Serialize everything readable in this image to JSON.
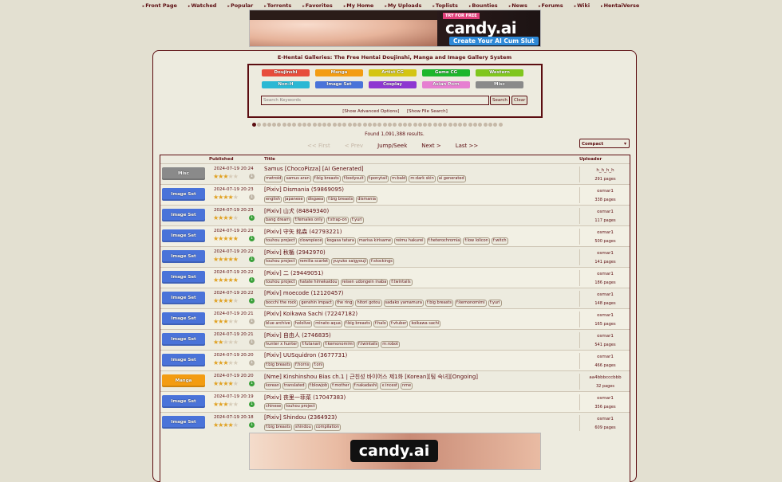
{
  "nav": [
    "Front Page",
    "Watched",
    "Popular",
    "Torrents",
    "Favorites",
    "My Home",
    "My Uploads",
    "Toplists",
    "Bounties",
    "News",
    "Forums",
    "Wiki",
    "HentaiVerse"
  ],
  "ad_top": {
    "try": "TRY FOR FREE",
    "brand": "candy.ai",
    "cta": "Create Your AI Cum Slut"
  },
  "ad_bottom": {
    "brand": "candy.ai"
  },
  "site_title": "E-Hentai Galleries: The Free Hentai Doujinshi, Manga and Image Gallery System",
  "categories": [
    {
      "label": "Doujinshi",
      "color": "#e74c3c"
    },
    {
      "label": "Manga",
      "color": "#f39c12"
    },
    {
      "label": "Artist CG",
      "color": "#d4c514"
    },
    {
      "label": "Game CG",
      "color": "#1db62c"
    },
    {
      "label": "Western",
      "color": "#80c61d"
    },
    {
      "label": "Non-H",
      "color": "#2bb8d4"
    },
    {
      "label": "Image Set",
      "color": "#4a73d9"
    },
    {
      "label": "Cosplay",
      "color": "#8e37d1"
    },
    {
      "label": "Asian Porn",
      "color": "#e67fd1"
    },
    {
      "label": "Misc",
      "color": "#8a8a8a"
    }
  ],
  "search": {
    "placeholder": "Search Keywords",
    "search_btn": "Search",
    "clear_btn": "Clear",
    "advanced": "[Show Advanced Options]",
    "file": "[Show File Search]"
  },
  "found": "Found 1,091,388 results.",
  "pager": {
    "first": "<< First",
    "prev": "< Prev",
    "jump": "Jump/Seek",
    "next": "Next >",
    "last": "Last >>"
  },
  "display_mode": "Compact",
  "table_headers": {
    "published": "Published",
    "title": "Title",
    "uploader": "Uploader"
  },
  "rows": [
    {
      "cat": "Misc",
      "color": "#8a8a8a",
      "date": "2024-07-19 20:24",
      "rating": 2.5,
      "title": "Samus [ChocoPizza] [AI Generated]",
      "tags": [
        "metroid",
        "samus aran",
        "f:big breasts",
        "f:bodysuit",
        "f:ponytail",
        "m:bald",
        "m:dark skin",
        "ai generated"
      ],
      "uploader": "h_h_h_h",
      "pages": "291 pages",
      "dl": "grey"
    },
    {
      "cat": "Image Set",
      "color": "#4a73d9",
      "date": "2024-07-19 20:23",
      "rating": 4,
      "title": "[Pixiv] Dismania (59869095)",
      "tags": [
        "english",
        "japanese",
        "disgaea",
        "f:big breasts",
        "dismania"
      ],
      "uploader": "osmar1",
      "pages": "338 pages",
      "dl": "grey"
    },
    {
      "cat": "Image Set",
      "color": "#4a73d9",
      "date": "2024-07-19 20:23",
      "rating": 3.5,
      "title": "[Pixiv] 山犬 (84849340)",
      "tags": [
        "bang dream",
        "f:females only",
        "f:strap-on",
        "f:yuri"
      ],
      "uploader": "osmar1",
      "pages": "117 pages",
      "dl": "green"
    },
    {
      "cat": "Image Set",
      "color": "#4a73d9",
      "date": "2024-07-19 20:23",
      "rating": 4.5,
      "title": "[Pixiv] 守矢 銘森 (42793221)",
      "tags": [
        "touhou project",
        "clownpiece",
        "kogasa tatara",
        "marisa kirisame",
        "reimu hakurei",
        "f:heterochromia",
        "f:low lolicon",
        "f:witch"
      ],
      "uploader": "osmar1",
      "pages": "500 pages",
      "dl": "green"
    },
    {
      "cat": "Image Set",
      "color": "#4a73d9",
      "date": "2024-07-19 20:22",
      "rating": 4.5,
      "title": "[Pixiv] 秋楯 (2942970)",
      "tags": [
        "touhou project",
        "remilia scarlet",
        "yuyuko saigyouji",
        "f:stockings"
      ],
      "uploader": "osmar1",
      "pages": "141 pages",
      "dl": "green"
    },
    {
      "cat": "Image Set",
      "color": "#4a73d9",
      "date": "2024-07-19 20:22",
      "rating": 4.5,
      "title": "[Pixiv] 二 (29449051)",
      "tags": [
        "touhou project",
        "hatate himekaidou",
        "reisen udongein inaba",
        "f:twintails"
      ],
      "uploader": "osmar1",
      "pages": "186 pages",
      "dl": "green"
    },
    {
      "cat": "Image Set",
      "color": "#4a73d9",
      "date": "2024-07-19 20:22",
      "rating": 4,
      "title": "[Pixiv] moecode (12120457)",
      "tags": [
        "bocchi the rock",
        "genshin impact",
        "the ring",
        "hitori gotou",
        "sadako yamamura",
        "f:big breasts",
        "f:kemonomimi",
        "f:yuri"
      ],
      "uploader": "osmar1",
      "pages": "148 pages",
      "dl": "green"
    },
    {
      "cat": "Image Set",
      "color": "#4a73d9",
      "date": "2024-07-19 20:21",
      "rating": 2.5,
      "title": "[Pixiv] Koikawa Sachi (72247182)",
      "tags": [
        "blue archive",
        "hololive",
        "minato aqua",
        "f:big breasts",
        "f:halo",
        "f:vtuber",
        "koikawa sachi"
      ],
      "uploader": "osmar1",
      "pages": "165 pages",
      "dl": "grey"
    },
    {
      "cat": "Image Set",
      "color": "#4a73d9",
      "date": "2024-07-19 20:21",
      "rating": 2,
      "title": "[Pixiv] 自由人 (2746835)",
      "tags": [
        "hunter x hunter",
        "f:futanari",
        "f:kemonomimi",
        "f:twintails",
        "m:robot"
      ],
      "uploader": "osmar1",
      "pages": "541 pages",
      "dl": "grey"
    },
    {
      "cat": "Image Set",
      "color": "#4a73d9",
      "date": "2024-07-19 20:20",
      "rating": 3,
      "title": "[Pixiv] UUSquidron (3677731)",
      "tags": [
        "f:big breasts",
        "f:horns",
        "f:oni"
      ],
      "uploader": "osmar1",
      "pages": "466 pages",
      "dl": "grey"
    },
    {
      "cat": "Manga",
      "color": "#f39c12",
      "date": "2024-07-19 20:20",
      "rating": 4,
      "title": "[Nme] Kinshinshou Bias ch.1 | 근친성 바이어스 제1화 [Korean][팀 숙녀][Ongoing]",
      "tags": [
        "korean",
        "translated",
        "f:blowjob",
        "f:mother",
        "f:nakadashi",
        "x:incest",
        "nme"
      ],
      "uploader": "aa4bbbcccbbb",
      "pages": "32 pages",
      "dl": "green"
    },
    {
      "cat": "Image Set",
      "color": "#4a73d9",
      "date": "2024-07-19 20:19",
      "rating": 3,
      "title": "[Pixiv] 丧里一菲菜 (17047383)",
      "tags": [
        "chinese",
        "touhou project"
      ],
      "uploader": "osmar1",
      "pages": "356 pages",
      "dl": "green"
    },
    {
      "cat": "Image Set",
      "color": "#4a73d9",
      "date": "2024-07-19 20:18",
      "rating": 4,
      "title": "[Pixiv] Shindou (2364923)",
      "tags": [
        "f:big breasts",
        "shindou",
        "compilation"
      ],
      "uploader": "osmar1",
      "pages": "609 pages",
      "dl": "green"
    }
  ]
}
